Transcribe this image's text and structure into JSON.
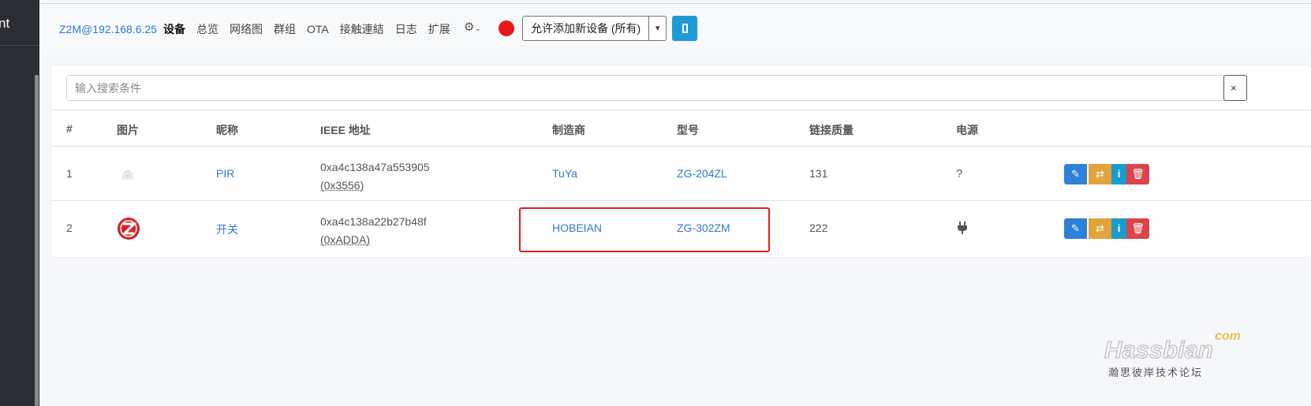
{
  "sidebar": {
    "title": "nt"
  },
  "nav": {
    "brand": "Z2M@192.168.6.25",
    "items": [
      "设备",
      "总览",
      "网络图",
      "群组",
      "OTA",
      "接触連結",
      "日志",
      "扩展"
    ],
    "settings_icon": "gear-icon",
    "status_color": "#e8151b",
    "permit_join_label": "允许添加新设备 (所有)",
    "dropdown_icon": "chevron-down-icon"
  },
  "search": {
    "placeholder": "输入搜索条件",
    "clear": "×"
  },
  "table": {
    "headers": [
      "#",
      "图片",
      "昵称",
      "IEEE 地址",
      "制造商",
      "型号",
      "链接质量",
      "电源"
    ],
    "rows": [
      {
        "index": "1",
        "image": "pir-sensor-icon",
        "name": "PIR",
        "ieee": "0xa4c138a47a553905",
        "nwk": "(0x3556)",
        "manufacturer": "TuYa",
        "model": "ZG-204ZL",
        "lqi": "131",
        "power": "?"
      },
      {
        "index": "2",
        "image": "zigbee-logo-icon",
        "name": "开关",
        "ieee": "0xa4c138a22b27b48f",
        "nwk": "(0xADDA)",
        "manufacturer": "HOBEIAN",
        "model": "ZG-302ZM",
        "lqi": "222",
        "power": "plug-icon"
      }
    ],
    "actions": [
      "edit-icon",
      "swap-icon",
      "info-icon",
      "trash-icon"
    ]
  },
  "watermark": {
    "com": "com",
    "main": "Hassbian",
    "cn": "瀚思彼岸技术论坛"
  }
}
